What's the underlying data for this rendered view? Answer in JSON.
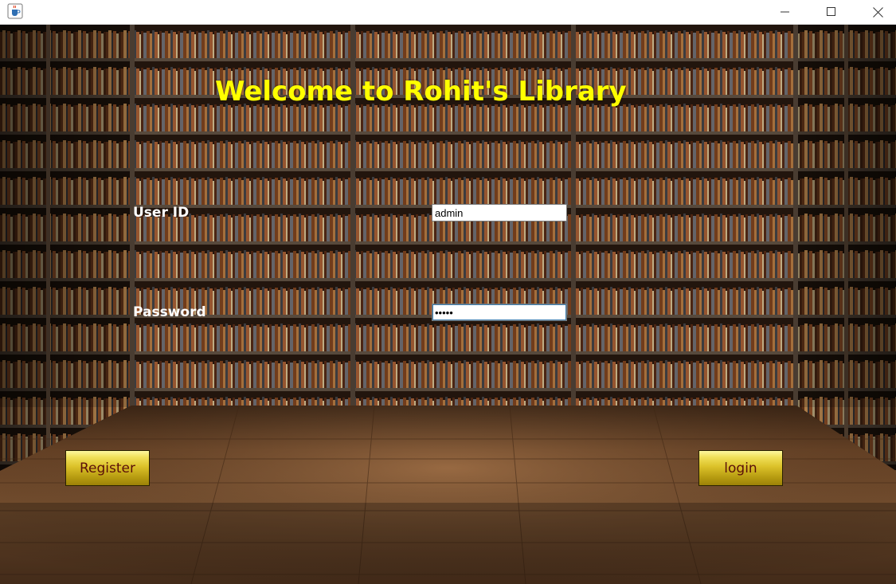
{
  "window": {
    "title": "",
    "controls": [
      "minimize",
      "maximize",
      "close"
    ]
  },
  "heading": "Welcome to Rohit's Library",
  "form": {
    "userid_label": "User ID",
    "userid_value": "admin",
    "password_label": "Password",
    "password_value": "admin"
  },
  "buttons": {
    "register_label": "Register",
    "login_label": "login"
  },
  "icons": {
    "app": "java-coffee-cup-icon",
    "minimize": "minimize-icon",
    "maximize": "maximize-icon",
    "close": "close-icon"
  },
  "colors": {
    "heading": "#ffff00",
    "labels": "#ffffff",
    "button_text": "#5a0f0a",
    "button_gold": "#dcc22a"
  }
}
